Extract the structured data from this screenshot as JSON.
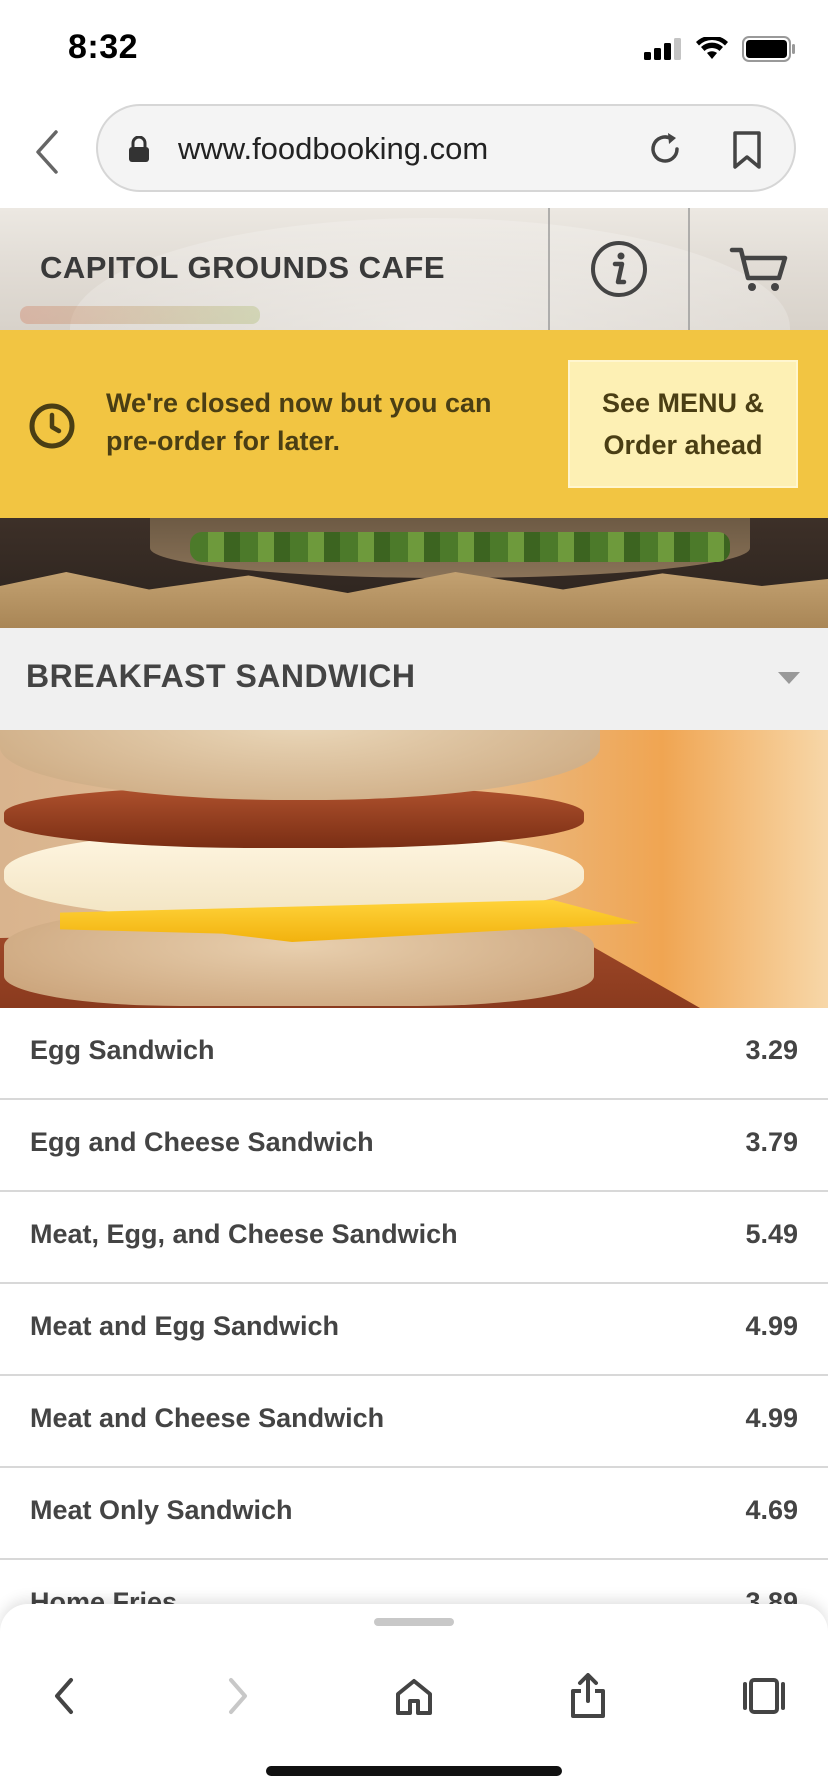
{
  "status_bar": {
    "time": "8:32"
  },
  "browser": {
    "url": "www.foodbooking.com"
  },
  "header": {
    "cafe_name": "CAPITOL GROUNDS CAFE"
  },
  "banner": {
    "message": "We're closed now but you can pre-order for later.",
    "button_label": "See MENU & Order ahead"
  },
  "section": {
    "title": "BREAKFAST SANDWICH"
  },
  "menu": {
    "items": [
      {
        "name": "Egg Sandwich",
        "price": "3.29"
      },
      {
        "name": "Egg and Cheese Sandwich",
        "price": "3.79"
      },
      {
        "name": "Meat, Egg, and Cheese Sandwich",
        "price": "5.49"
      },
      {
        "name": "Meat and Egg Sandwich",
        "price": "4.99"
      },
      {
        "name": "Meat and Cheese Sandwich",
        "price": "4.99"
      },
      {
        "name": "Meat Only Sandwich",
        "price": "4.69"
      },
      {
        "name": "Home Fries",
        "price": "3.89"
      }
    ]
  },
  "colors": {
    "banner_bg": "#f2c542",
    "banner_text": "#4a3e14",
    "order_button_bg": "#fdf0b4",
    "section_bg": "#f0f0f0"
  },
  "icons": {
    "status": [
      "signal-icon",
      "wifi-icon",
      "battery-icon"
    ],
    "url_bar": [
      "back-chevron-icon",
      "lock-icon",
      "reload-icon",
      "bookmark-icon"
    ],
    "header": [
      "info-icon",
      "cart-icon"
    ],
    "banner": "clock-icon",
    "section": "caret-down-icon",
    "toolbar": [
      "back-arrow-icon",
      "forward-arrow-icon",
      "home-icon",
      "share-icon",
      "tabs-icon"
    ]
  }
}
